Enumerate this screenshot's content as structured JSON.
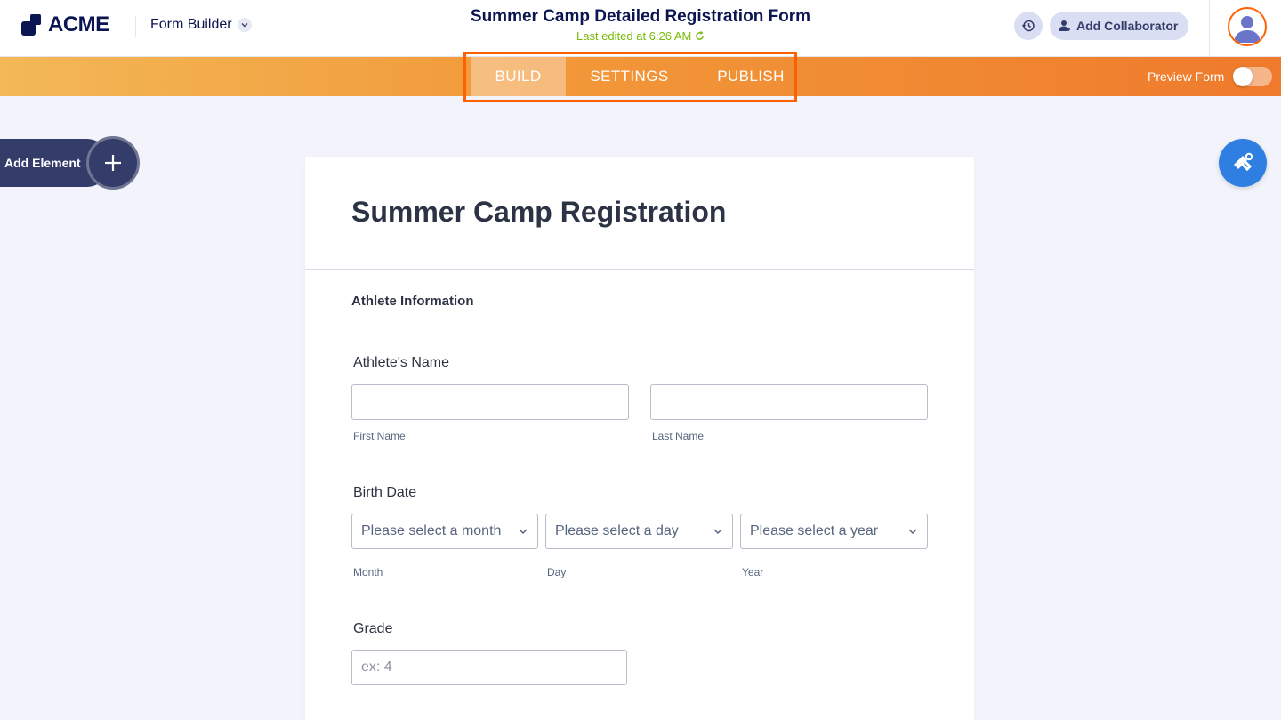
{
  "header": {
    "logo_text": "ACME",
    "app_name": "Form Builder",
    "form_title": "Summer Camp Detailed Registration Form",
    "last_edited": "Last edited at 6:26 AM",
    "collaborator_label": "Add Collaborator"
  },
  "nav": {
    "tabs": [
      {
        "label": "BUILD",
        "active": true
      },
      {
        "label": "SETTINGS",
        "active": false
      },
      {
        "label": "PUBLISH",
        "active": false
      }
    ],
    "preview_label": "Preview Form",
    "preview_on": false
  },
  "sidebar": {
    "add_element_label": "Add Element"
  },
  "form": {
    "title": "Summer Camp Registration",
    "section": "Athlete Information",
    "name_field": {
      "label": "Athlete's Name",
      "first_sublabel": "First Name",
      "last_sublabel": "Last Name",
      "first_value": "",
      "last_value": ""
    },
    "birth_field": {
      "label": "Birth Date",
      "month_placeholder": "Please select a month",
      "day_placeholder": "Please select a day",
      "year_placeholder": "Please select a year",
      "month_sublabel": "Month",
      "day_sublabel": "Day",
      "year_sublabel": "Year"
    },
    "grade_field": {
      "label": "Grade",
      "placeholder": "ex: 4"
    }
  },
  "colors": {
    "accent": "#ff6100",
    "navy": "#0a1551",
    "edited_green": "#78bb07",
    "designer_blue": "#2f7fe3"
  }
}
